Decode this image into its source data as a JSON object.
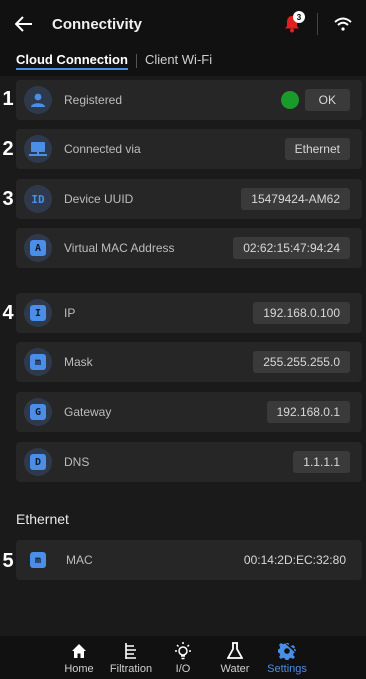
{
  "header": {
    "title": "Connectivity",
    "notification_count": "3"
  },
  "tabs": [
    {
      "label": "Cloud Connection",
      "active": true
    },
    {
      "label": "Client Wi-Fi",
      "active": false
    }
  ],
  "rows": [
    {
      "number": "1",
      "icon_glyph": "👤",
      "icon": "user-icon",
      "label": "Registered",
      "value": "OK",
      "status": "green"
    },
    {
      "number": "2",
      "icon_glyph": "🖥",
      "icon": "monitor-icon",
      "label": "Connected via",
      "value": "Ethernet"
    },
    {
      "number": "3",
      "icon_glyph": "ID",
      "icon": "id-icon",
      "label": "Device UUID",
      "value": "15479424-AM62"
    },
    {
      "number": "",
      "icon_glyph": "A",
      "icon": "a-icon",
      "label": "Virtual MAC Address",
      "value": "02:62:15:47:94:24"
    },
    {
      "number": "4",
      "icon_glyph": "I",
      "icon": "i-icon",
      "label": "IP",
      "value": "192.168.0.100"
    },
    {
      "number": "",
      "icon_glyph": "m",
      "icon": "m-icon",
      "label": "Mask",
      "value": "255.255.255.0"
    },
    {
      "number": "",
      "icon_glyph": "G",
      "icon": "g-icon",
      "label": "Gateway",
      "value": "192.168.0.1"
    },
    {
      "number": "",
      "icon_glyph": "D",
      "icon": "d-icon",
      "label": "DNS",
      "value": "1.1.1.1"
    }
  ],
  "ethernet": {
    "section_title": "Ethernet",
    "row": {
      "number": "5",
      "icon_glyph": "m",
      "icon": "m-icon",
      "label": "MAC",
      "value": "00:14:2D:EC:32:80"
    }
  },
  "nav": [
    {
      "label": "Home",
      "icon": "home-icon",
      "active": false
    },
    {
      "label": "Filtration",
      "icon": "filtration-icon",
      "active": false
    },
    {
      "label": "I/O",
      "icon": "bulb-icon",
      "active": false
    },
    {
      "label": "Water",
      "icon": "flask-icon",
      "active": false
    },
    {
      "label": "Settings",
      "icon": "gear-icon",
      "active": true
    }
  ],
  "colors": {
    "accent": "#4a8ee8",
    "status_ok": "#1a9a2a",
    "bell": "#e02020"
  }
}
